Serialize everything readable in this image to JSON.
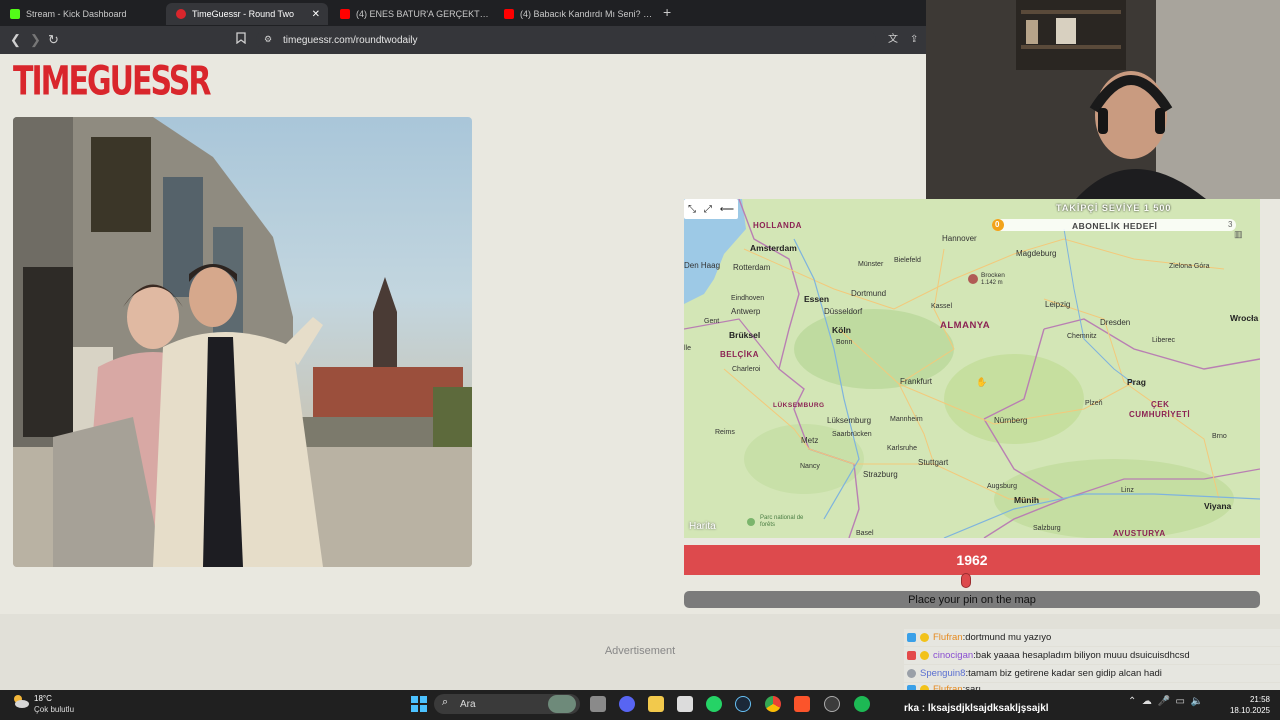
{
  "browser": {
    "tabs": [
      {
        "label": "Stream - Kick Dashboard",
        "icon": "kick-icon",
        "color": "#53fc18"
      },
      {
        "label": "TimeGuessr - Round Two",
        "icon": "timeguessr-icon",
        "color": "#d9262c"
      },
      {
        "label": "(4) ENES BATUR'A GERÇEKTEN NE OL",
        "icon": "youtube-icon",
        "color": "#ff0000"
      },
      {
        "label": "(4) Babacık Kandırdı Mı Seni? - YouTu",
        "icon": "youtube-icon",
        "color": "#ff0000"
      }
    ],
    "url": "timeguessr.com/roundtwodaily"
  },
  "page": {
    "logo": "TIMEGUESSR",
    "year": "1962",
    "year_fraction": 0.49,
    "place_pin": "Place your pin on the map",
    "advertisement": "Advertisement"
  },
  "map": {
    "attribution": "Harita",
    "countries": [
      "HOLLANDA",
      "BELÇİKA",
      "LÜKSEMBURG",
      "ALMANYA",
      "ÇEK",
      "CUMHURİYETİ",
      "AVUSTURYA"
    ],
    "cities": [
      "Amsterdam",
      "Den Haag",
      "Rotterdam",
      "Eindhoven",
      "Antwerp",
      "Gent",
      "Brüksel",
      "Charleroi",
      "Essen",
      "Dortmund",
      "Düsseldorf",
      "Köln",
      "Bonn",
      "Münster",
      "Bielefeld",
      "Hannover",
      "Magdeburg",
      "Brocken",
      "1.142 m",
      "Kassel",
      "Leipzig",
      "Chemnitz",
      "Dresden",
      "Liberec",
      "Zielona Góra",
      "Wrocła",
      "Frankfurt",
      "Prag",
      "Plzeň",
      "Lüksemburg",
      "Mannheim",
      "Nürnberg",
      "Reims",
      "Metz",
      "Saarbrücken",
      "Karlsruhe",
      "Stuttgart",
      "Nancy",
      "Strazburg",
      "Augsburg",
      "Münih",
      "Linz",
      "Brno",
      "Viyana",
      "Salzburg",
      "Basel",
      "Parc national de forêts",
      "lle"
    ]
  },
  "stream_overlay": {
    "goal_title": "TAKİPÇİ SEVİYE 1 500",
    "goal_label": "ABONELİK HEDEFİ",
    "goal_start": "0",
    "goal_end": "3",
    "goal_progress": 0.0,
    "chat": [
      {
        "user": "Flufran",
        "sep": " : ",
        "msg": "dortmund mu yazıyo",
        "color": "#e58a1f"
      },
      {
        "user": "cinocigan",
        "sep": " : ",
        "msg": "bak yaaaa hesapladım biliyon muuu dsuicuisdhcsd",
        "color": "#8a4fd1"
      },
      {
        "user": "Spenguin8",
        "sep": " : ",
        "msg": "tamam biz getirene kadar sen gidip alcan hadi",
        "color": "#5a6fd1"
      },
      {
        "user": "Flufran",
        "sep": " : ",
        "msg": "sarı",
        "color": "#e58a1f"
      }
    ],
    "bottom_line": "rka : lksajsdjklsajdksakljşsajkl"
  },
  "taskbar": {
    "temperature": "18°C",
    "condition": "Çok bulutlu",
    "search": "Ara",
    "time": "21:58",
    "date": "18.10.2025"
  }
}
